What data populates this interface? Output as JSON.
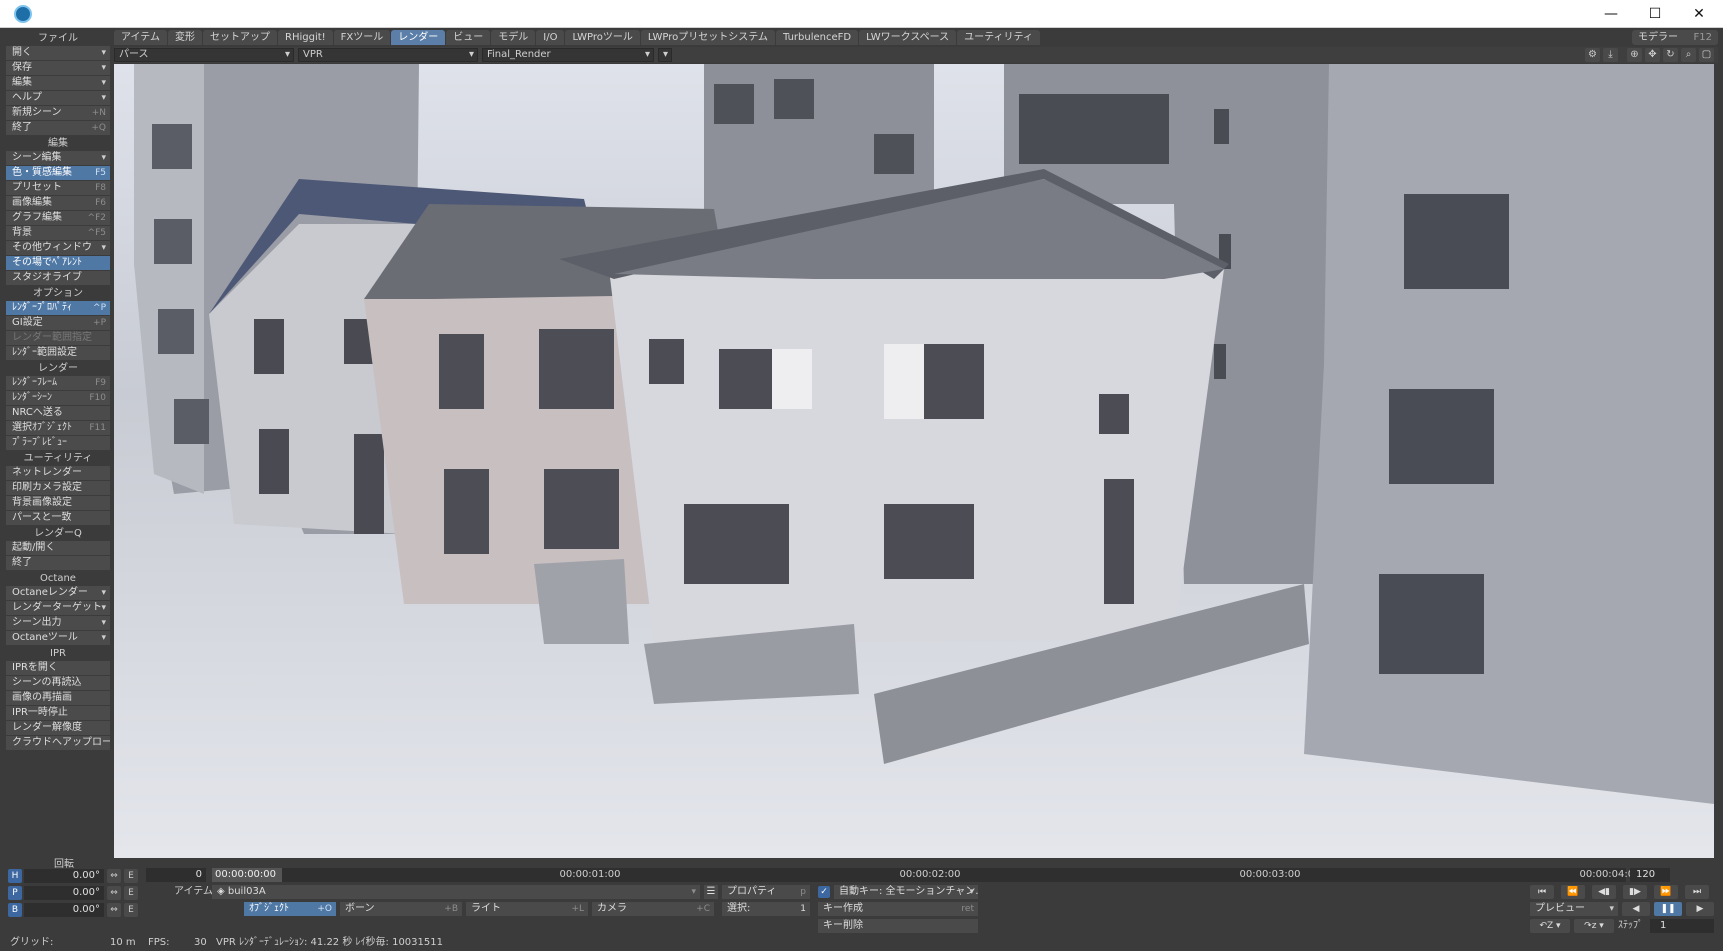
{
  "window": {
    "minimize": "—",
    "maximize": "☐",
    "close": "✕"
  },
  "tabs": [
    "アイテム",
    "変形",
    "セットアップ",
    "RHiggit!",
    "FXツール",
    "レンダー",
    "ビュー",
    "モデル",
    "I/O",
    "LWProツール",
    "LWProプリセットシステム",
    "TurbulenceFD",
    "LWワークスペース",
    "ユーティリティ"
  ],
  "active_tab": "レンダー",
  "modeler": {
    "label": "モデラー",
    "key": "F12"
  },
  "viewport": {
    "view_type": "パース",
    "render_mode": "VPR",
    "camera": "Final_Render"
  },
  "sidebar": [
    {
      "title": "ファイル",
      "items": [
        {
          "label": "開く",
          "chev": true
        },
        {
          "label": "保存",
          "chev": true
        },
        {
          "label": "編集",
          "chev": true
        },
        {
          "label": "ヘルプ",
          "chev": true
        },
        {
          "label": "新規シーン",
          "sc": "+N"
        },
        {
          "label": "終了",
          "sc": "+Q"
        }
      ]
    },
    {
      "title": "編集",
      "items": [
        {
          "label": "シーン編集",
          "chev": true
        },
        {
          "label": "色・質感編集",
          "sc": "F5",
          "active": true
        },
        {
          "label": "プリセット",
          "sc": "F8"
        },
        {
          "label": "画像編集",
          "sc": "F6"
        },
        {
          "label": "グラフ編集",
          "sc": "^F2"
        },
        {
          "label": "背景",
          "sc": "^F5"
        },
        {
          "label": "その他ウィンドウ",
          "chev": true
        },
        {
          "label": "その場でﾍﾟｱﾚﾝﾄ",
          "active": true
        },
        {
          "label": "スタジオライブ"
        }
      ]
    },
    {
      "title": "オプション",
      "items": [
        {
          "label": "ﾚﾝﾀﾞｰﾌﾟﾛﾊﾟﾃｨ",
          "sc": "^P",
          "active": true
        },
        {
          "label": "GI設定",
          "sc": "+P"
        },
        {
          "label": "レンダー範囲指定",
          "disabled": true
        },
        {
          "label": "ﾚﾝﾀﾞｰ範囲設定"
        }
      ]
    },
    {
      "title": "レンダー",
      "items": [
        {
          "label": "ﾚﾝﾀﾞｰﾌﾚｰﾑ",
          "sc": "F9"
        },
        {
          "label": "ﾚﾝﾀﾞｰｼｰﾝ",
          "sc": "F10"
        },
        {
          "label": "NRCへ送る"
        },
        {
          "label": "選択ｵﾌﾞｼﾞｪｸﾄ",
          "sc": "F11"
        },
        {
          "label": "ﾌﾟﾗｰﾌﾞﾚﾋﾞｭｰ"
        }
      ]
    },
    {
      "title": "ユーティリティ",
      "items": [
        {
          "label": "ネットレンダー"
        },
        {
          "label": "印刷カメラ設定"
        },
        {
          "label": "背景画像設定"
        },
        {
          "label": "パースと一致"
        }
      ]
    },
    {
      "title": "レンダーQ",
      "items": [
        {
          "label": "起動/開く"
        },
        {
          "label": "終了"
        }
      ]
    },
    {
      "title": "Octane",
      "items": [
        {
          "label": "Octaneレンダー",
          "chev": true
        },
        {
          "label": "レンダーターゲット",
          "chev": true
        },
        {
          "label": "シーン出力",
          "chev": true
        },
        {
          "label": "Octaneツール",
          "chev": true
        }
      ]
    },
    {
      "title": "IPR",
      "items": [
        {
          "label": "IPRを開く"
        },
        {
          "label": "シーンの再読込"
        },
        {
          "label": "画像の再描画"
        },
        {
          "label": "IPR一時停止"
        },
        {
          "label": "レンダー解像度"
        },
        {
          "label": "クラウドへアップロード"
        }
      ]
    }
  ],
  "rotation_label": "回転",
  "hpb": [
    {
      "axis": "H",
      "value": "0.00°"
    },
    {
      "axis": "P",
      "value": "0.00°"
    },
    {
      "axis": "B",
      "value": "0.00°"
    }
  ],
  "grid": {
    "label": "グリッド:",
    "value": "10 m"
  },
  "fps": {
    "label": "FPS:",
    "value": "30"
  },
  "vpr_status": "VPR ﾚﾝﾀﾞｰﾃﾞｭﾚｰｼｮﾝ: 41.22 秒  ﾚｲ秒毎: 10031511",
  "timeline": {
    "current_frame": "0",
    "current_time": "00:00:00:00",
    "ticks": [
      "00:00:01:00",
      "00:00:02:00",
      "00:00:03:00",
      "00:00:04:00"
    ],
    "end_frame": "120"
  },
  "item": {
    "label": "アイテム",
    "value": "buil03A",
    "properties": {
      "label": "プロパティ",
      "sc": "p"
    },
    "object": {
      "label": "ｵﾌﾞｼﾞｪｸﾄ",
      "sc": "+O"
    },
    "bone": {
      "label": "ボーン",
      "sc": "+B"
    },
    "light": {
      "label": "ライト",
      "sc": "+L"
    },
    "camera": {
      "label": "カメラ",
      "sc": "+C"
    },
    "selection": {
      "label": "選択:",
      "value": "1"
    }
  },
  "keys": {
    "auto_key": "自動キー: 全モーションチャン…",
    "create_key": "キー作成",
    "create_sc": "ret",
    "delete_key": "キー削除"
  },
  "transport": {
    "preview": "プレビュー",
    "step_label": "ｽﾃｯﾌﾟ",
    "step_value": "1",
    "buttons": [
      "⏮",
      "⏪",
      "◀▮",
      "▮▶",
      "⏩",
      "⏭"
    ]
  },
  "icons": {
    "settings": "gear-icon",
    "download": "download-icon",
    "orbit": "orbit-icon",
    "move": "move-icon",
    "rotate": "rotate-icon",
    "zoom": "zoom-icon",
    "max": "maximize-icon"
  }
}
